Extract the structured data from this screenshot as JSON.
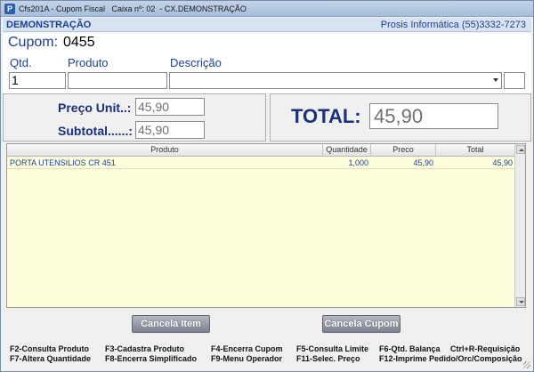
{
  "window": {
    "title": "Cfs201A - Cupom Fiscal   Caixa nº: 02  - CX.DEMONSTRAÇÃO",
    "icon": "P"
  },
  "header": {
    "left": "DEMONSTRAÇÃO",
    "right": "Prosis Informática (55)3332-7273"
  },
  "cupom": {
    "label": "Cupom:",
    "value": "0455"
  },
  "entry": {
    "qtd_label": "Qtd.",
    "produto_label": "Produto",
    "descricao_label": "Descrição",
    "qtd_value": "1",
    "produto_value": "",
    "descricao_value": "",
    "extra_value": ""
  },
  "price": {
    "unit_label": "Preço Unit..:",
    "unit_value": "45,90",
    "subtotal_label": "Subtotal......:",
    "subtotal_value": "45,90"
  },
  "total": {
    "label": "TOTAL:",
    "value": "45,90"
  },
  "grid": {
    "columns": [
      "Produto",
      "Quantidade",
      "Preco",
      "Total"
    ],
    "rows": [
      {
        "produto": "PORTA UTENSILIOS CR 451",
        "quantidade": "1,000",
        "preco": "45,90",
        "total": "45,90"
      }
    ]
  },
  "buttons": {
    "cancela_item": "Cancela Item",
    "cancela_cupom": "Cancela Cupom"
  },
  "shortcuts": [
    "F2-Consulta Produto",
    "F3-Cadastra Produto",
    "F4-Encerra Cupom",
    "F5-Consulta Limite",
    "F6-Qtd. Balança",
    "Ctrl+R-Requisição",
    "F7-Altera Quantidade",
    "F8-Encerra Simplificado",
    "F9-Menu Operador",
    "F11-Selec. Preço",
    "F12-Imprime Pedido/Orc/Composição"
  ]
}
